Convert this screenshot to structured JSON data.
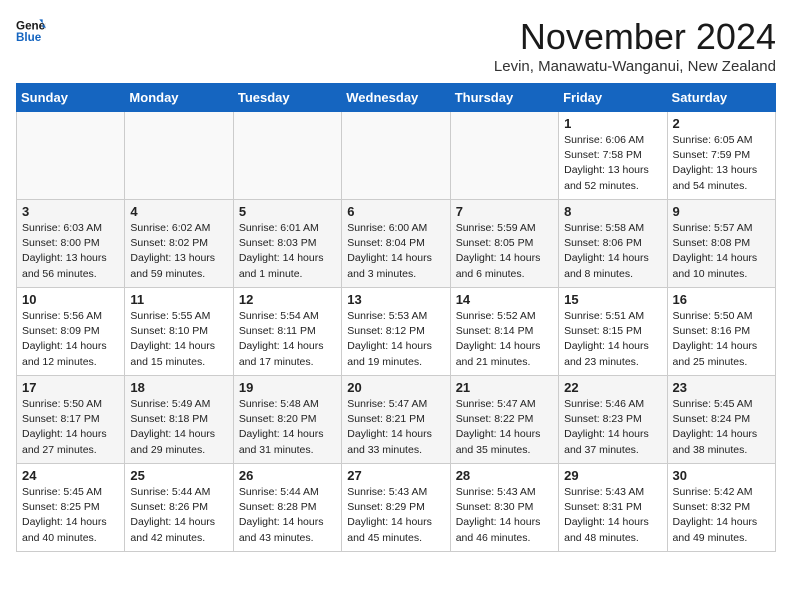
{
  "header": {
    "logo_line1": "General",
    "logo_line2": "Blue",
    "month_year": "November 2024",
    "location": "Levin, Manawatu-Wanganui, New Zealand"
  },
  "weekdays": [
    "Sunday",
    "Monday",
    "Tuesday",
    "Wednesday",
    "Thursday",
    "Friday",
    "Saturday"
  ],
  "weeks": [
    [
      {
        "day": "",
        "info": ""
      },
      {
        "day": "",
        "info": ""
      },
      {
        "day": "",
        "info": ""
      },
      {
        "day": "",
        "info": ""
      },
      {
        "day": "",
        "info": ""
      },
      {
        "day": "1",
        "info": "Sunrise: 6:06 AM\nSunset: 7:58 PM\nDaylight: 13 hours\nand 52 minutes."
      },
      {
        "day": "2",
        "info": "Sunrise: 6:05 AM\nSunset: 7:59 PM\nDaylight: 13 hours\nand 54 minutes."
      }
    ],
    [
      {
        "day": "3",
        "info": "Sunrise: 6:03 AM\nSunset: 8:00 PM\nDaylight: 13 hours\nand 56 minutes."
      },
      {
        "day": "4",
        "info": "Sunrise: 6:02 AM\nSunset: 8:02 PM\nDaylight: 13 hours\nand 59 minutes."
      },
      {
        "day": "5",
        "info": "Sunrise: 6:01 AM\nSunset: 8:03 PM\nDaylight: 14 hours\nand 1 minute."
      },
      {
        "day": "6",
        "info": "Sunrise: 6:00 AM\nSunset: 8:04 PM\nDaylight: 14 hours\nand 3 minutes."
      },
      {
        "day": "7",
        "info": "Sunrise: 5:59 AM\nSunset: 8:05 PM\nDaylight: 14 hours\nand 6 minutes."
      },
      {
        "day": "8",
        "info": "Sunrise: 5:58 AM\nSunset: 8:06 PM\nDaylight: 14 hours\nand 8 minutes."
      },
      {
        "day": "9",
        "info": "Sunrise: 5:57 AM\nSunset: 8:08 PM\nDaylight: 14 hours\nand 10 minutes."
      }
    ],
    [
      {
        "day": "10",
        "info": "Sunrise: 5:56 AM\nSunset: 8:09 PM\nDaylight: 14 hours\nand 12 minutes."
      },
      {
        "day": "11",
        "info": "Sunrise: 5:55 AM\nSunset: 8:10 PM\nDaylight: 14 hours\nand 15 minutes."
      },
      {
        "day": "12",
        "info": "Sunrise: 5:54 AM\nSunset: 8:11 PM\nDaylight: 14 hours\nand 17 minutes."
      },
      {
        "day": "13",
        "info": "Sunrise: 5:53 AM\nSunset: 8:12 PM\nDaylight: 14 hours\nand 19 minutes."
      },
      {
        "day": "14",
        "info": "Sunrise: 5:52 AM\nSunset: 8:14 PM\nDaylight: 14 hours\nand 21 minutes."
      },
      {
        "day": "15",
        "info": "Sunrise: 5:51 AM\nSunset: 8:15 PM\nDaylight: 14 hours\nand 23 minutes."
      },
      {
        "day": "16",
        "info": "Sunrise: 5:50 AM\nSunset: 8:16 PM\nDaylight: 14 hours\nand 25 minutes."
      }
    ],
    [
      {
        "day": "17",
        "info": "Sunrise: 5:50 AM\nSunset: 8:17 PM\nDaylight: 14 hours\nand 27 minutes."
      },
      {
        "day": "18",
        "info": "Sunrise: 5:49 AM\nSunset: 8:18 PM\nDaylight: 14 hours\nand 29 minutes."
      },
      {
        "day": "19",
        "info": "Sunrise: 5:48 AM\nSunset: 8:20 PM\nDaylight: 14 hours\nand 31 minutes."
      },
      {
        "day": "20",
        "info": "Sunrise: 5:47 AM\nSunset: 8:21 PM\nDaylight: 14 hours\nand 33 minutes."
      },
      {
        "day": "21",
        "info": "Sunrise: 5:47 AM\nSunset: 8:22 PM\nDaylight: 14 hours\nand 35 minutes."
      },
      {
        "day": "22",
        "info": "Sunrise: 5:46 AM\nSunset: 8:23 PM\nDaylight: 14 hours\nand 37 minutes."
      },
      {
        "day": "23",
        "info": "Sunrise: 5:45 AM\nSunset: 8:24 PM\nDaylight: 14 hours\nand 38 minutes."
      }
    ],
    [
      {
        "day": "24",
        "info": "Sunrise: 5:45 AM\nSunset: 8:25 PM\nDaylight: 14 hours\nand 40 minutes."
      },
      {
        "day": "25",
        "info": "Sunrise: 5:44 AM\nSunset: 8:26 PM\nDaylight: 14 hours\nand 42 minutes."
      },
      {
        "day": "26",
        "info": "Sunrise: 5:44 AM\nSunset: 8:28 PM\nDaylight: 14 hours\nand 43 minutes."
      },
      {
        "day": "27",
        "info": "Sunrise: 5:43 AM\nSunset: 8:29 PM\nDaylight: 14 hours\nand 45 minutes."
      },
      {
        "day": "28",
        "info": "Sunrise: 5:43 AM\nSunset: 8:30 PM\nDaylight: 14 hours\nand 46 minutes."
      },
      {
        "day": "29",
        "info": "Sunrise: 5:43 AM\nSunset: 8:31 PM\nDaylight: 14 hours\nand 48 minutes."
      },
      {
        "day": "30",
        "info": "Sunrise: 5:42 AM\nSunset: 8:32 PM\nDaylight: 14 hours\nand 49 minutes."
      }
    ]
  ]
}
